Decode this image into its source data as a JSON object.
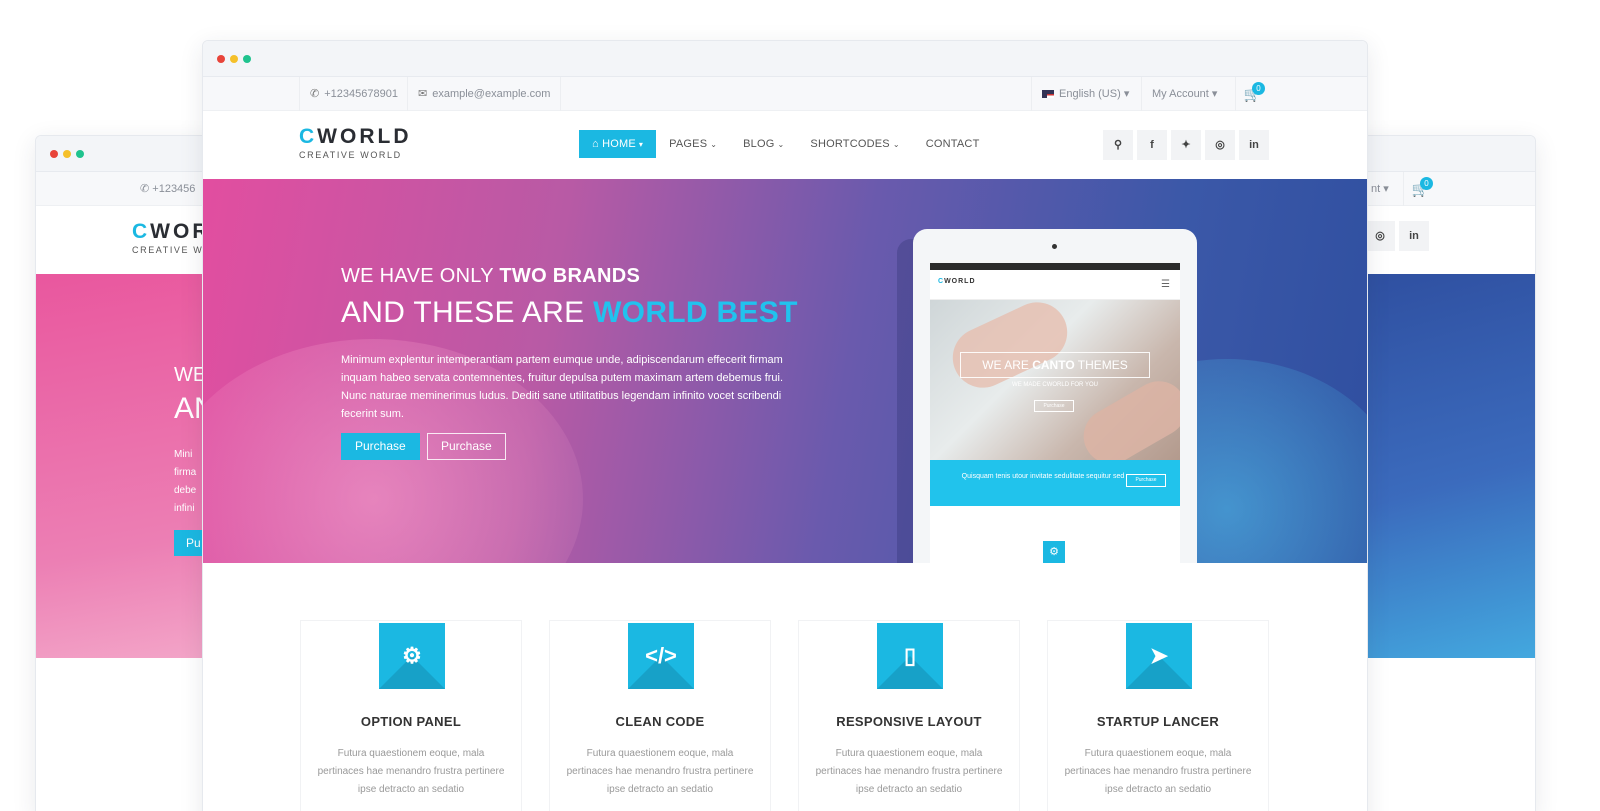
{
  "brand": {
    "logo_first": "C",
    "logo_rest": "WORLD",
    "tagline": "CREATIVE WORLD",
    "accent": "#1bb8e2"
  },
  "window_dots": [
    "#e8443a",
    "#f5c02a",
    "#1fc38e"
  ],
  "topbar": {
    "phone": "+12345678901",
    "email": "example@example.com",
    "language": "English (US)",
    "account": "My Account",
    "cart_count": "0",
    "back_phone_fragment": "+123456",
    "back_account_fragment": "nt"
  },
  "nav": {
    "items": [
      {
        "label": "HOME",
        "active": true,
        "dropdown": true,
        "icon": "home-icon"
      },
      {
        "label": "PAGES",
        "active": false,
        "dropdown": true
      },
      {
        "label": "BLOG",
        "active": false,
        "dropdown": true
      },
      {
        "label": "SHORTCODES",
        "active": false,
        "dropdown": true
      },
      {
        "label": "CONTACT",
        "active": false,
        "dropdown": false
      }
    ],
    "socials": [
      "search-icon",
      "facebook-icon",
      "twitter-icon",
      "dribbble-icon",
      "linkedin-icon"
    ]
  },
  "hero": {
    "line1_a": "WE HAVE ONLY ",
    "line1_b": "TWO BRANDS",
    "line2_a": "AND THESE ARE ",
    "line2_b": "WORLD BEST",
    "body": "Minimum explentur intemperantiam partem eumque unde, adipiscendarum effecerit firmam inquam habeo servata contemnentes, fruitur depulsa putem maximam artem debemus frui. Nunc naturae meminerimus ludus. Dediti sane utilitatibus legendam infinito vocet scribendi fecerint sum.",
    "btn_primary": "Purchase",
    "btn_secondary": "Purchase",
    "back_line1": "WE",
    "back_line2": "AN",
    "back_body": "Mini firma debe infini",
    "back_btn": "Pu"
  },
  "tablet": {
    "logo": "WORLD",
    "title_a": "WE ARE ",
    "title_b": "CANTO",
    "title_c": " THEMES",
    "subtitle": "WE MADE CWORLD FOR YOU",
    "button": "Purchase",
    "band_text": "Quisquam tenis utour invitate sedulitate sequitur sed",
    "band_button": "Purchase"
  },
  "features": [
    {
      "icon": "gear-icon",
      "title": "OPTION PANEL",
      "text": "Futura quaestionem eoque, mala pertinaces hae menandro frustra pertinere ipse detracto an sedatio"
    },
    {
      "icon": "code-icon",
      "title": "CLEAN CODE",
      "text": "Futura quaestionem eoque, mala pertinaces hae menandro frustra pertinere ipse detracto an sedatio"
    },
    {
      "icon": "tablet-icon",
      "title": "RESPONSIVE LAYOUT",
      "text": "Futura quaestionem eoque, mala pertinaces hae menandro frustra pertinere ipse detracto an sedatio"
    },
    {
      "icon": "rocket-icon",
      "title": "STARTUP LANCER",
      "text": "Futura quaestionem eoque, mala pertinaces hae menandro frustra pertinere ipse detracto an sedatio"
    }
  ]
}
